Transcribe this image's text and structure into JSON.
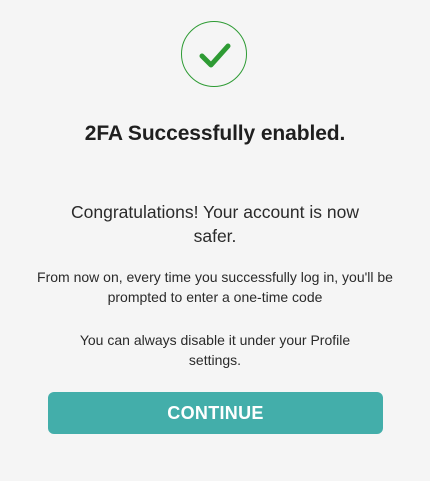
{
  "success_dialog": {
    "icon": "checkmark-circle-icon",
    "title": "2FA Successfully enabled.",
    "lead": "Congratulations! Your account is now safer.",
    "info": "From now on, every time you successfully log in, you'll be prompted to enter a one-time code",
    "hint": "You can always disable it under your Profile settings.",
    "continue_label": "CONTINUE",
    "accent_color": "#2e9b34",
    "button_color": "#43aeaa"
  }
}
